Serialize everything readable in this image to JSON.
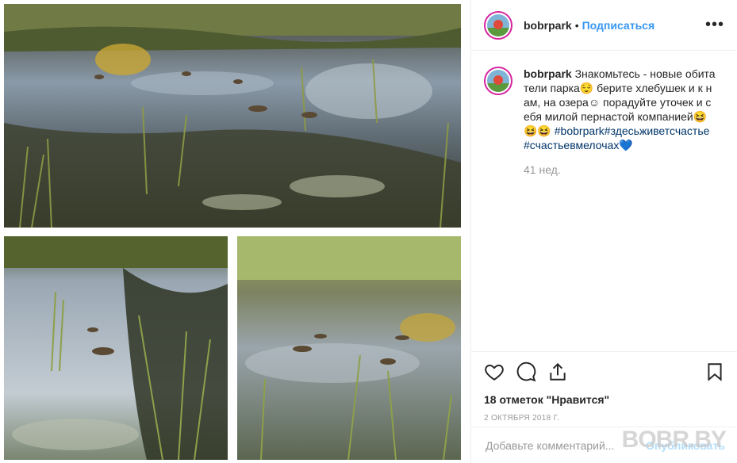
{
  "post": {
    "username": "bobrpark",
    "follow_label": "Подписаться",
    "more_icon": "more-horizontal-icon"
  },
  "caption": {
    "username": "bobrpark",
    "text": "Знакомьтесь - новые обитатели парка😌 берите хлебушек и к нам, на озера☺ порадуйте уточек и себя милой пернастой компанией😆😆😆",
    "hashtags": "#bobrpark#здесьживетсчастье#счастьевмелочах💙",
    "age": "41 нед."
  },
  "actions": {
    "like_icon": "heart-icon",
    "comment_icon": "comment-icon",
    "share_icon": "share-icon",
    "save_icon": "bookmark-icon",
    "likes_text": "18 отметок \"Нравится\"",
    "date": "2 октября 2018 г."
  },
  "comment": {
    "placeholder": "Добавьте комментарий...",
    "publish_label": "Опубликовать"
  },
  "watermark": "BOBR.BY",
  "colors": {
    "link_blue": "#3897f0",
    "hashtag_blue": "#003569",
    "muted": "#999999"
  }
}
